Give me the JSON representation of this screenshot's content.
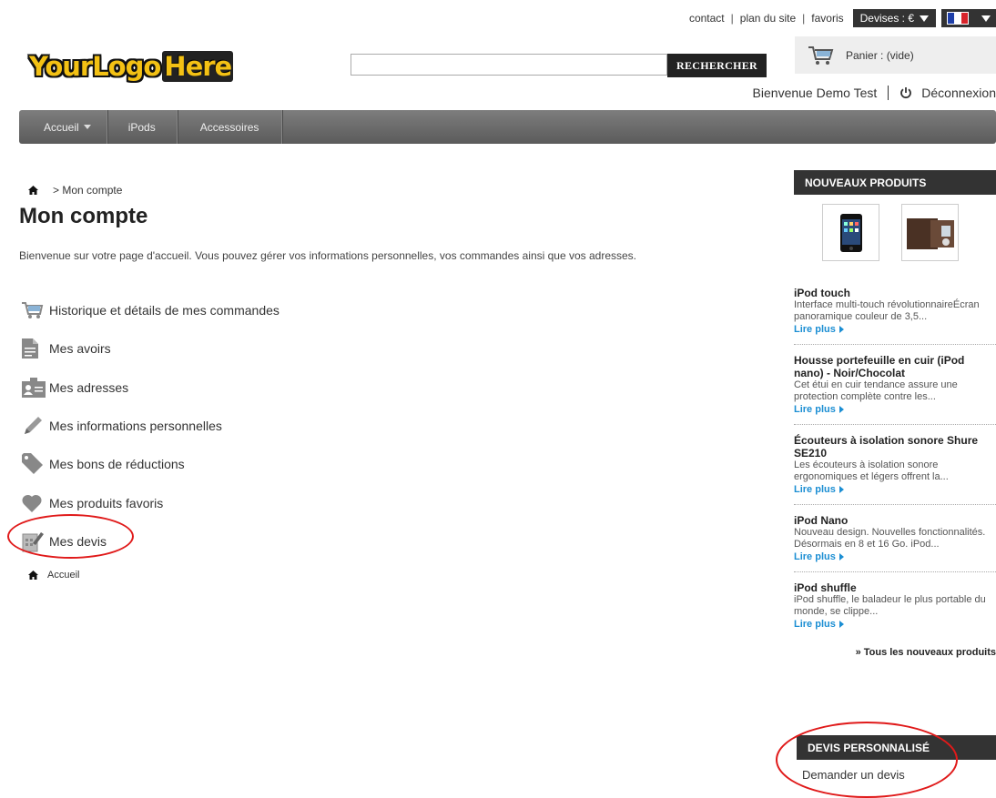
{
  "header": {
    "links": [
      "contact",
      "plan du site",
      "favoris"
    ],
    "currency_label": "Devises : €",
    "logo_part1": "YourLogo",
    "logo_part2": "Here",
    "search_placeholder": "",
    "search_button": "RECHERCHER",
    "cart_label": "Panier : (vide)",
    "welcome": "Bienvenue Demo Test",
    "logout": "Déconnexion"
  },
  "nav": {
    "items": [
      "Accueil",
      "iPods",
      "Accessoires"
    ]
  },
  "breadcrumb": {
    "current": "> Mon compte"
  },
  "main": {
    "title": "Mon compte",
    "intro": "Bienvenue sur votre page d'accueil. Vous pouvez gérer vos informations personnelles, vos commandes ainsi que vos adresses.",
    "menu": [
      {
        "label": "Historique et détails de mes commandes",
        "icon": "cart-icon"
      },
      {
        "label": "Mes avoirs",
        "icon": "document-icon"
      },
      {
        "label": "Mes adresses",
        "icon": "address-card-icon"
      },
      {
        "label": "Mes informations personnelles",
        "icon": "pencil-icon"
      },
      {
        "label": "Mes bons de réductions",
        "icon": "tag-icon"
      },
      {
        "label": "Mes produits favoris",
        "icon": "heart-icon"
      },
      {
        "label": "Mes devis",
        "icon": "quote-icon"
      }
    ],
    "home_link": "Accueil"
  },
  "sidebar": {
    "new_products_title": "NOUVEAUX PRODUITS",
    "products": [
      {
        "name": "iPod touch",
        "desc": "Interface multi-touch révolutionnaireÉcran panoramique couleur de 3,5...",
        "more": "Lire plus"
      },
      {
        "name": "Housse portefeuille en cuir (iPod nano) - Noir/Chocolat",
        "desc": "Cet étui en cuir tendance assure une protection complète contre les...",
        "more": "Lire plus"
      },
      {
        "name": "Écouteurs à isolation sonore Shure SE210",
        "desc": "Les écouteurs à isolation sonore ergonomiques et légers offrent la...",
        "more": "Lire plus"
      },
      {
        "name": "iPod Nano",
        "desc": "Nouveau design. Nouvelles fonctionnalités. Désormais en 8 et 16 Go. iPod...",
        "more": "Lire plus"
      },
      {
        "name": "iPod shuffle",
        "desc": "iPod shuffle, le baladeur le plus portable du monde, se clippe...",
        "more": "Lire plus"
      }
    ],
    "all_new": "» Tous les nouveaux produits",
    "devis_title": "DEVIS PERSONNALISÉ",
    "devis_link": "Demander un devis"
  },
  "colors": {
    "accent_link": "#1b8ed3",
    "highlight_circle": "#e01a1a",
    "nav_bg": "#6b6b6b",
    "block_header": "#333333"
  }
}
